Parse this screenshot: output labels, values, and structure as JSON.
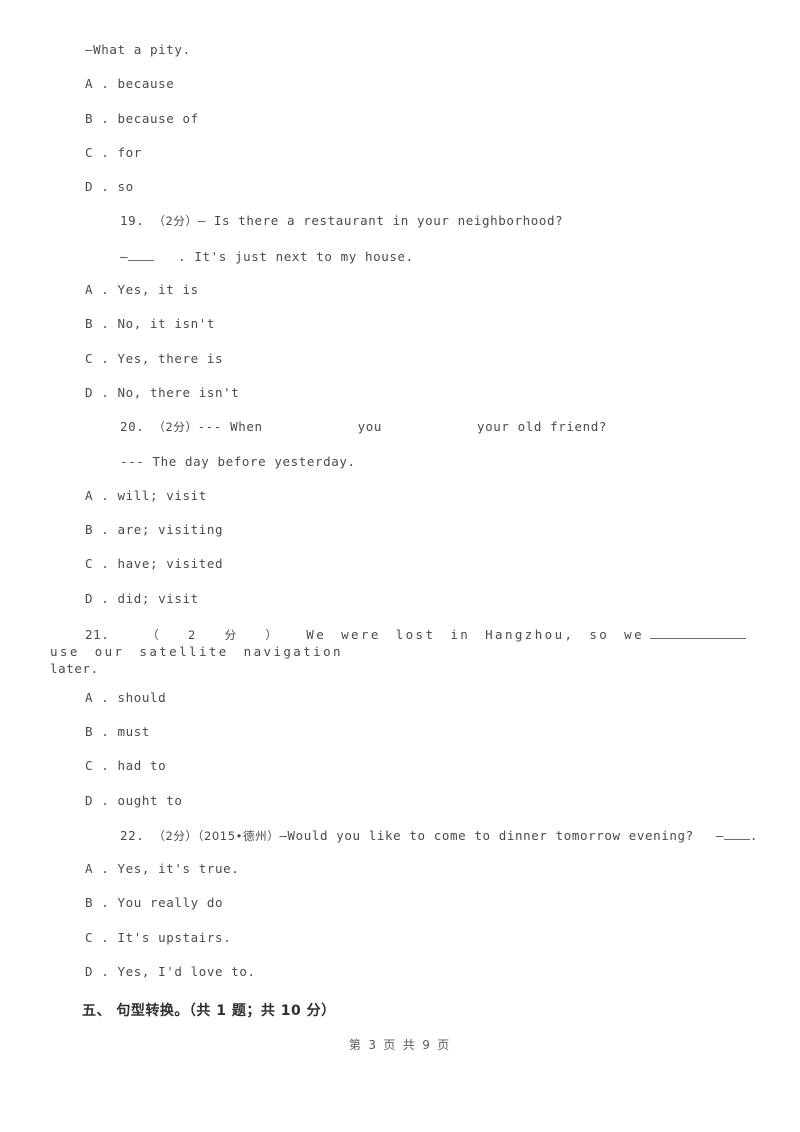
{
  "document": {
    "type": "exam-worksheet-page",
    "language": "zh-CN / en",
    "page_label": "第 3 页 共 9 页",
    "footer_text": "第 3 页 共 9 页"
  },
  "continued_question": {
    "stem_tail": "—What a pity.",
    "options": [
      "A . because",
      "B . because of",
      "C . for",
      "D . so"
    ]
  },
  "questions": [
    {
      "number": "19.",
      "points": "（2分）",
      "stem_line1": "— Is there a restaurant in your neighborhood?",
      "stem_line2_prefix": "—",
      "stem_line2_suffix": ". It's just next to my house.",
      "options": [
        "A . Yes, it is",
        "B . No, it isn't",
        "C . Yes, there is",
        "D . No, there isn't"
      ]
    },
    {
      "number": "20.",
      "points": "（2分）",
      "stem_line1_a": "--- When",
      "stem_line1_b": "you",
      "stem_line1_c": "your old friend?",
      "stem_line2": "--- The day before yesterday.",
      "options": [
        "A . will; visit",
        "B . are; visiting",
        "C . have; visited",
        "D . did; visit"
      ]
    },
    {
      "number": "21.",
      "points": "（2分）",
      "stem_a": "We were lost in Hangzhou, so we",
      "stem_b": "use our satellite navigation",
      "stem_c": "later.",
      "options": [
        "A . should",
        "B . must",
        "C . had to",
        "D . ought to"
      ]
    },
    {
      "number": "22.",
      "points": "（2分）",
      "source": "（2015•德州）",
      "stem_a": "—Would you like to come to dinner tomorrow evening?",
      "stem_b": "—",
      "stem_c": ".",
      "options": [
        "A . Yes, it's true.",
        "B . You really do",
        "C . It's upstairs.",
        "D . Yes, I'd love to."
      ]
    }
  ],
  "section": {
    "heading": "五、 句型转换。（共 1 题；共 10 分）"
  }
}
